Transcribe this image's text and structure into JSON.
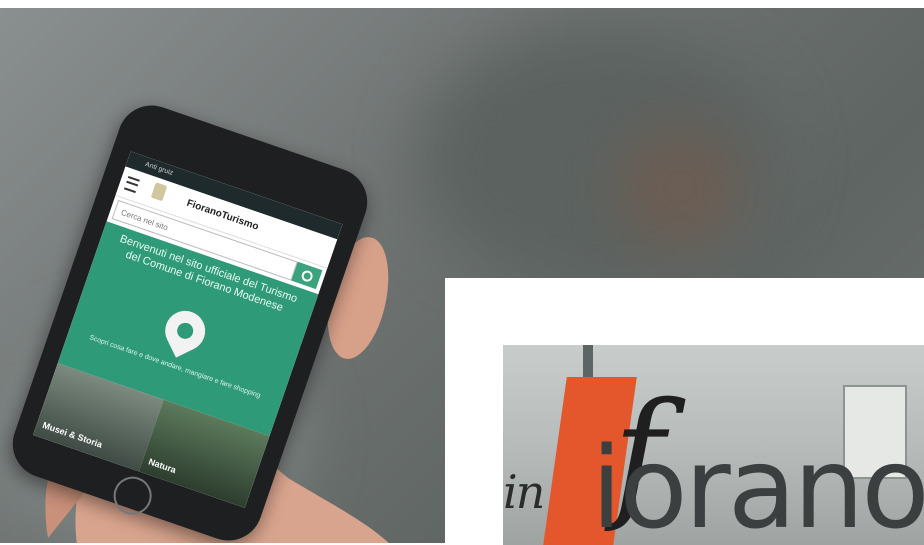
{
  "photo1": {
    "phone_app": {
      "status_text": "Anti gruiz",
      "site_name": "FioranoTurismo",
      "search_placeholder": "Cerca nel sito",
      "welcome": "Benvenuti nel sito ufficiale del Turismo del Comune di Fiorano Modenese",
      "sub_text": "Scopri cosa fare e dove andare, mangiare e fare shopping",
      "tile_left": "Musei & Storia",
      "tile_right": "Natura",
      "colors": {
        "accent": "#2f9a78",
        "dark": "#1f2a2d"
      }
    }
  },
  "photo2": {
    "script_text": "in",
    "logo_text": "iorano",
    "logo_initial": "f",
    "colors": {
      "orange": "#e4562b"
    }
  }
}
